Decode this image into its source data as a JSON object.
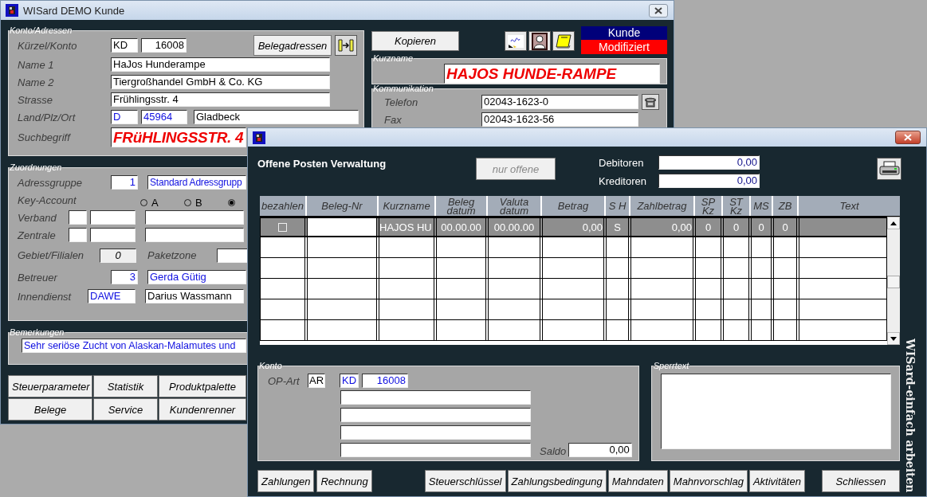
{
  "customer_window": {
    "title": "WISard DEMO Kunde",
    "address": {
      "legend": "Konto/Adressen",
      "belegadressen_button": "Belegadressen",
      "kuerzel": {
        "label": "Kürzel/Konto",
        "code": "KD",
        "account": "16008"
      },
      "names": [
        {
          "label": "Name 1",
          "value": "HaJos Hunderampe"
        },
        {
          "label": "Name 2",
          "value": "Tiergroßhandel GmbH & Co. KG"
        },
        {
          "label": "Strasse",
          "value": "Frühlingsstr. 4"
        }
      ],
      "location": {
        "label": "Land/Plz/Ort",
        "country": "D",
        "zip": "45964",
        "city": "Gladbeck"
      },
      "search_term": {
        "label": "Suchbegriff",
        "value": "FRüHLINGSSTR. 4"
      }
    },
    "assignments": {
      "legend": "Zuordnungen",
      "address_group": {
        "label": "Adressgruppe",
        "number": "1",
        "name": "Standard Adressgrupp"
      },
      "key_account": {
        "label": "Key-Account",
        "options": [
          {
            "label": "A",
            "selected": false
          },
          {
            "label": "B",
            "selected": false
          },
          {
            "selected": true
          }
        ]
      },
      "verband": {
        "label": "Verband"
      },
      "zentrale": {
        "label": "Zentrale"
      },
      "area": {
        "label": "Gebiet/Filialen",
        "value": "0"
      },
      "parcel_zone": {
        "label": "Paketzone"
      },
      "betreuer": {
        "label": "Betreuer",
        "number": "3",
        "name": "Gerda Gütig"
      },
      "innendienst": {
        "label": "Innendienst",
        "code": "DAWE",
        "name": "Darius Wassmann"
      }
    },
    "remarks": {
      "legend": "Bemerkungen",
      "value": "Sehr seriöse Zucht von Alaskan-Malamutes und"
    },
    "buttons": [
      "Steuerparameter",
      "Statistik",
      "Produktpalette",
      "Belege",
      "Service",
      "Kundenrenner"
    ],
    "copy_button": "Kopieren",
    "status": {
      "type": "Kunde",
      "state": "Modifiziert"
    },
    "short_name": {
      "legend": "Kurzname",
      "value": "HAJOS HUNDE-RAMPE"
    },
    "communication": {
      "legend": "Kommunikation",
      "rows": [
        {
          "label": "Telefon",
          "value": "02043-1623-0"
        },
        {
          "label": "Fax",
          "value": "02043-1623-56"
        }
      ]
    }
  },
  "op_window": {
    "heading": "Offene Posten Verwaltung",
    "filter_button": {
      "label": "nur offene",
      "disabled": true
    },
    "totals": [
      {
        "label": "Debitoren",
        "value": "0,00"
      },
      {
        "label": "Kreditoren",
        "value": "0,00"
      }
    ],
    "table": {
      "columns": [
        "bezahlen",
        "Beleg-Nr",
        "Kurzname",
        "Beleg datum",
        "Valuta datum",
        "Betrag",
        "S H",
        "Zahlbetrag",
        "SP Kz",
        "ST Kz",
        "MS",
        "ZB",
        "Text"
      ],
      "rows": [
        {
          "selected": true,
          "checked": false,
          "kurzname": "HAJOS HU",
          "beleg_datum": "00.00.00",
          "valuta_datum": "00.00.00",
          "betrag": "0,00",
          "sh": "S",
          "zahlbetrag": "0,00",
          "sp_kz": "0",
          "st_kz": "0",
          "ms": "0",
          "zb": "0"
        }
      ]
    },
    "account": {
      "legend": "Konto",
      "op_art_label": "OP-Art",
      "op_art": "AR",
      "code": "KD",
      "number": "16008",
      "saldo_label": "Saldo",
      "saldo": "0,00"
    },
    "block_text": {
      "legend": "Sperrtext"
    },
    "slogan": "WISard-einfach arbeiten",
    "left_buttons": [
      "Zahlungen",
      "Rechnung"
    ],
    "middle_buttons": [
      "Steuerschlüssel",
      "Zahlungsbedingung",
      "Mahndaten",
      "Mahnvorschlag",
      "Aktivitäten"
    ],
    "close_button": "Schliessen"
  }
}
